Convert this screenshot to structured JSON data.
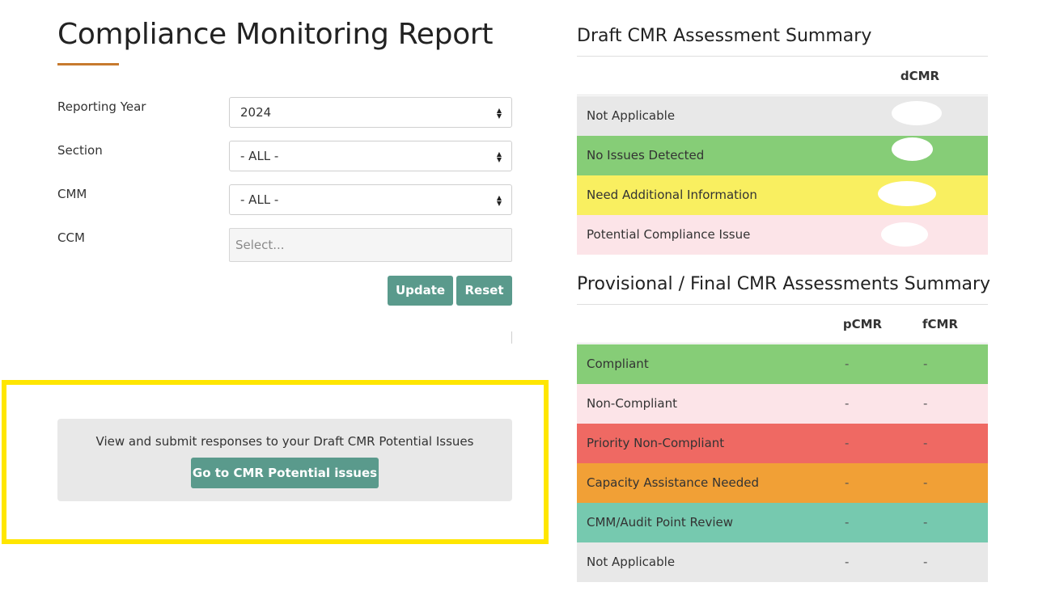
{
  "page": {
    "title": "Compliance Monitoring Report"
  },
  "filters": {
    "reporting_year": {
      "label": "Reporting Year",
      "value": "2024"
    },
    "section": {
      "label": "Section",
      "value": "- ALL -"
    },
    "cmm": {
      "label": "CMM",
      "value": "- ALL -"
    },
    "ccm": {
      "label": "CCM",
      "placeholder": "Select..."
    },
    "update_label": "Update",
    "reset_label": "Reset"
  },
  "potential_issues": {
    "text": "View and submit responses to your Draft CMR Potential Issues",
    "button_label": "Go to CMR Potential issues"
  },
  "draft_summary": {
    "title": "Draft CMR Assessment Summary",
    "column": "dCMR",
    "rows": [
      {
        "label": "Not Applicable",
        "color": "#e8e8e8"
      },
      {
        "label": "No Issues Detected",
        "color": "#86cd77"
      },
      {
        "label": "Need Additional Information",
        "color": "#f9ef60"
      },
      {
        "label": "Potential Compliance Issue",
        "color": "#fce4e8"
      }
    ]
  },
  "final_summary": {
    "title": "Provisional / Final CMR Assessments Summary",
    "columns": [
      "pCMR",
      "fCMR"
    ],
    "rows": [
      {
        "label": "Compliant",
        "color": "#86cd77",
        "pcmr": "-",
        "fcmr": "-"
      },
      {
        "label": "Non-Compliant",
        "color": "#fce4e8",
        "pcmr": "-",
        "fcmr": "-"
      },
      {
        "label": "Priority Non-Compliant",
        "color": "#ef6963",
        "pcmr": "-",
        "fcmr": "-"
      },
      {
        "label": "Capacity Assistance Needed",
        "color": "#f1a036",
        "pcmr": "-",
        "fcmr": "-"
      },
      {
        "label": "CMM/Audit Point Review",
        "color": "#76c9af",
        "pcmr": "-",
        "fcmr": "-"
      },
      {
        "label": "Not Applicable",
        "color": "#e8e8e8",
        "pcmr": "-",
        "fcmr": "-"
      }
    ]
  }
}
